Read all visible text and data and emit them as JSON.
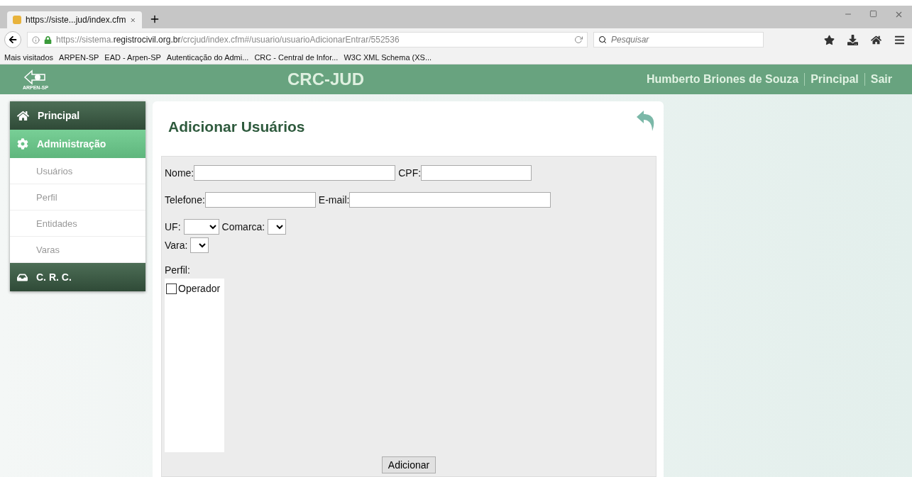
{
  "browser": {
    "tab_title": "https://siste...jud/index.cfm",
    "url": "https://sistema.**registrocivil.org.br**/crcjud/index.cfm#/usuario/usuarioAdicionarEntrar/552536",
    "search": {
      "placeholder": "Pesquisar"
    },
    "bookmarks": [
      "Mais visitados",
      "ARPEN-SP",
      "EAD - Arpen-SP",
      "Autenticação do Admi...",
      "CRC - Central de Infor...",
      "W3C XML Schema (XS..."
    ]
  },
  "header": {
    "logo_text": "ARPEN-SP",
    "title": "CRC-JUD",
    "links": [
      "Humberto Briones de Souza",
      "Principal",
      "Sair"
    ]
  },
  "sidebar": {
    "items": [
      {
        "kind": "section",
        "label": "Principal",
        "selected": false
      },
      {
        "kind": "section",
        "label": "Administração",
        "selected": true
      },
      {
        "kind": "sub",
        "label": "Usuários",
        "selected": false
      },
      {
        "kind": "sub",
        "label": "Perfil",
        "selected": false
      },
      {
        "kind": "sub",
        "label": "Entidades",
        "selected": false
      },
      {
        "kind": "sub",
        "label": "Varas",
        "selected": false
      },
      {
        "kind": "section",
        "label": "C. R. C.",
        "selected": false
      }
    ]
  },
  "form": {
    "title": "Adicionar Usuários",
    "rows": [
      [
        {
          "kind": "text",
          "label": "Nome:"
        },
        {
          "kind": "text",
          "label": "CPF:"
        }
      ],
      [
        {
          "kind": "text",
          "label": "Telefone:"
        },
        {
          "kind": "text",
          "label": "E-mail:"
        }
      ],
      [
        {
          "kind": "select",
          "label": "UF:"
        },
        {
          "kind": "select",
          "label": "Comarca:"
        }
      ],
      [
        {
          "kind": "select",
          "label": "Vara:"
        }
      ]
    ],
    "profile_label": "Perfil:",
    "profiles": [
      {
        "label": "Operador",
        "checked": false
      }
    ],
    "submit": "Adicionar"
  }
}
